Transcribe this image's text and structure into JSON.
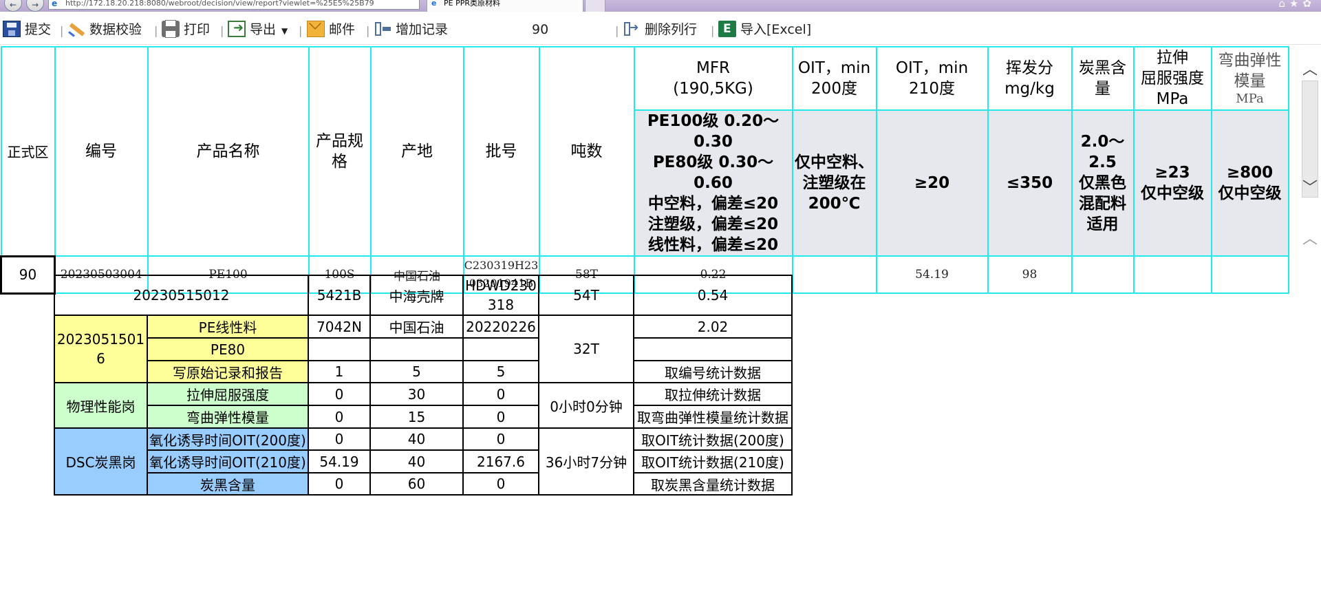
{
  "browser": {
    "url": "http://172.18.20.218:8080/webroot/decision/view/report?viewlet=%25E5%25B79",
    "tab_title": "PE PPR类原材料"
  },
  "toolbar": {
    "submit": "提交",
    "validate": "数据校验",
    "print": "打印",
    "export": "导出",
    "mail": "邮件",
    "add_record": "增加记录",
    "count_value": "90",
    "delete_row": "删除列行",
    "import_excel": "导入[Excel]"
  },
  "grid": {
    "zone_label": "正式区",
    "headers": {
      "number": "编号",
      "product_name": "产品名称",
      "spec": "产品规格",
      "origin": "产地",
      "batch": "批号",
      "tonnage": "吨数",
      "mfr": "MFR\n(190,5KG)",
      "oit200": "OIT，min\n200度",
      "oit210": "OIT，min\n210度",
      "volatile": "挥发分\nmg/kg",
      "carbon": "炭黑含量",
      "tensile": "拉伸\n屈服强度\nMPa",
      "flex_line1": "弯曲弹性",
      "flex_line2": "模量",
      "flex_line3": "MPa"
    },
    "requirements": {
      "mfr": "PE100级 0.20～0.30\nPE80级 0.30～0.60\n中空料，偏差≤20\n注塑级，偏差≤20\n线性料，偏差≤20",
      "oit200": "仅中空料、\n注塑级在\n200℃",
      "oit210": "≥20",
      "volatile": "≤350",
      "carbon": "2.0～\n2.5\n仅黑色\n混配料\n适用",
      "tensile": "≥23\n仅中空级",
      "flex": "≥800\n仅中空级"
    },
    "row": {
      "index": "90",
      "number": "20230503004",
      "product_name": "PE100",
      "spec": "100S",
      "origin": "中国石油",
      "batch": "C230319H23\n03201941B",
      "tonnage": "58T",
      "mfr": "0.22",
      "oit200": "",
      "oit210": "54.19",
      "volatile": "98",
      "carbon": "",
      "tensile": "",
      "flex": ""
    }
  },
  "summary": {
    "r1": {
      "number": "20230515012",
      "spec": "5421B",
      "origin": "中海壳牌",
      "batch": "HDWD230\n318",
      "tons": "54T",
      "value": "0.54"
    },
    "g2": {
      "number": "2023051501\n6",
      "tons": "32T",
      "rows": [
        {
          "label": "PE线性料",
          "spec": "7042N",
          "origin": "中国石油",
          "batch": "20220226",
          "value": "2.02"
        },
        {
          "label": "PE80",
          "spec": "",
          "origin": "",
          "batch": "",
          "value": ""
        },
        {
          "label": "写原始记录和报告",
          "spec": "1",
          "origin": "5",
          "batch": "5",
          "value": "取编号统计数据"
        }
      ]
    },
    "g3": {
      "group": "物理性能岗",
      "time": "0小时0分钟",
      "rows": [
        {
          "label": "拉伸屈服强度",
          "spec": "0",
          "origin": "30",
          "batch": "0",
          "value": "取拉伸统计数据"
        },
        {
          "label": "弯曲弹性模量",
          "spec": "0",
          "origin": "15",
          "batch": "0",
          "value": "取弯曲弹性模量统计数据"
        }
      ]
    },
    "g4": {
      "group": "DSC炭黑岗",
      "time": "36小时7分钟",
      "rows": [
        {
          "label": "氧化诱导时间OIT(200度)",
          "spec": "0",
          "origin": "40",
          "batch": "0",
          "value": "取OIT统计数据(200度)"
        },
        {
          "label": "氧化诱导时间OIT(210度)",
          "spec": "54.19",
          "origin": "40",
          "batch": "2167.6",
          "value": "取OIT统计数据(210度)"
        },
        {
          "label": "炭黑含量",
          "spec": "0",
          "origin": "60",
          "batch": "0",
          "value": "取炭黑含量统计数据"
        }
      ]
    }
  },
  "colors": {
    "grid_border": "#22e9ec",
    "spec_row_bg": "#e6e8ee",
    "yellow": "#ffff99",
    "green": "#ccffcc",
    "blue": "#99ccff"
  }
}
